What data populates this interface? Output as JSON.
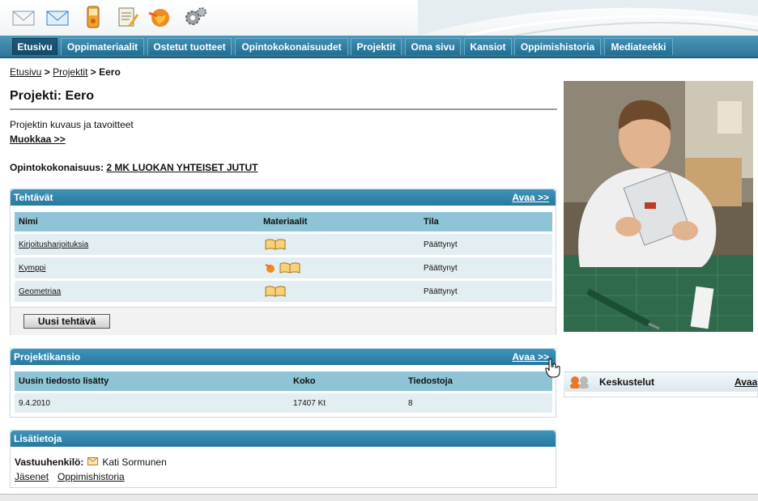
{
  "nav": {
    "tabs": [
      "Etusivu",
      "Oppimateriaalit",
      "Ostetut tuotteet",
      "Opintokokonaisuudet",
      "Projektit",
      "Oma sivu",
      "Kansiot",
      "Oppimishistoria",
      "Mediateekki"
    ]
  },
  "breadcrumb": {
    "home": "Etusivu",
    "sep": ">",
    "projects": "Projektit",
    "current": "Eero"
  },
  "title": "Projekti: Eero",
  "description": "Projektin kuvaus ja tavoitteet",
  "edit_link": "Muokkaa >>",
  "course": {
    "label": "Opintokokonaisuus:",
    "value": "2 MK LUOKAN YHTEISET JUTUT"
  },
  "tasks": {
    "title": "Tehtävät",
    "open": "Avaa >>",
    "headers": [
      "Nimi",
      "Materiaalit",
      "Tila"
    ],
    "rows": [
      {
        "name": "Kirjoitusharjoituksia",
        "status": "Päättynyt"
      },
      {
        "name": "Kymppi",
        "status": "Päättynyt"
      },
      {
        "name": "Geometriaa",
        "status": "Päättynyt"
      }
    ],
    "new_button": "Uusi tehtävä"
  },
  "folder": {
    "title": "Projektikansio",
    "open": "Avaa >>",
    "headers": [
      "Uusin tiedosto lisätty",
      "Koko",
      "Tiedostoja"
    ],
    "row": {
      "date": "9.4.2010",
      "size": "17407 Kt",
      "count": "8"
    }
  },
  "info": {
    "title": "Lisätietoja",
    "responsible_label": "Vastuuhenkilö:",
    "responsible": "Kati Sormunen",
    "members": "Jäsenet",
    "history": "Oppimishistoria"
  },
  "discussions": {
    "title": "Keskustelut",
    "open": "Avaa"
  },
  "colors": {
    "nav": "#2f7596",
    "panel_head": "#2878a0",
    "table_head": "#8ec4d6",
    "row": "#e3eef2"
  }
}
